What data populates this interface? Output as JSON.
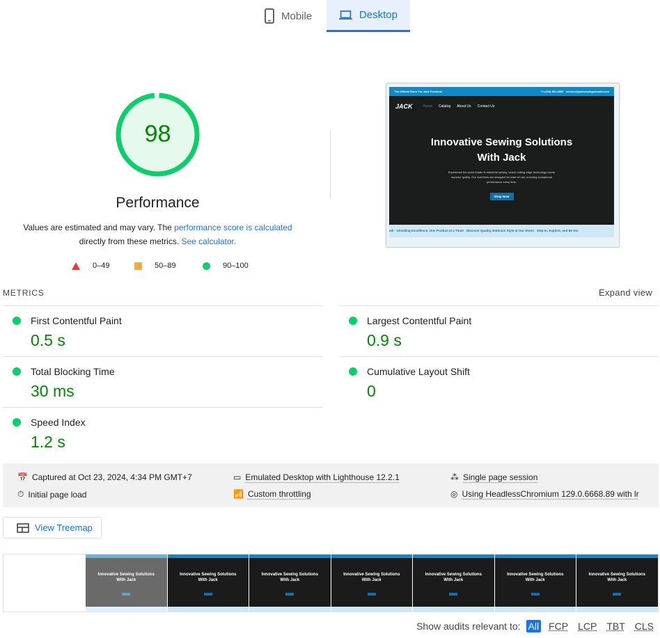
{
  "tabs": [
    {
      "label": "Mobile",
      "icon": "phone-icon"
    },
    {
      "label": "Desktop",
      "icon": "laptop-icon",
      "active": true
    }
  ],
  "score": {
    "value": "98",
    "title": "Performance",
    "fraction": 0.98,
    "color": "#0cce6b"
  },
  "description": {
    "text1": "Values are estimated and may vary. The ",
    "link1": "performance score is calculated",
    "text2": "directly from these metrics. ",
    "link2": "See calculator."
  },
  "legend": [
    {
      "range": "0–49",
      "color": "#ff3333"
    },
    {
      "range": "50–89",
      "color": "#ffaa33"
    },
    {
      "range": "90–100",
      "color": "#0cce6b"
    }
  ],
  "screenshot": {
    "topbar": "The Official Store For Jack Products",
    "phone": "+1 (416) 561-6660",
    "email": "service@jacksewingcanada.com",
    "logo": "JACK",
    "nav": [
      "Home",
      "Catalog",
      "About Us",
      "Contact Us"
    ],
    "headline1": "Innovative Sewing Solutions",
    "headline2": "With Jack",
    "body": "Experience the world leader in industrial sewing, where cutting-edge technology meets superior quality. Our machines are designed for ease of use, ensuring exceptional performance every time.",
    "cta": "Shop Now",
    "marquee": "ed!   Unveiling Excellence, One Product at a Time!   Discover Quality, Embrace Style at Our Store!   Step In, Explore, and Be Ins"
  },
  "metrics": {
    "heading": "METRICS",
    "expand": "Expand view",
    "items": [
      {
        "label": "First Contentful Paint",
        "value": "0.5 s"
      },
      {
        "label": "Largest Contentful Paint",
        "value": "0.9 s"
      },
      {
        "label": "Total Blocking Time",
        "value": "30 ms"
      },
      {
        "label": "Cumulative Layout Shift",
        "value": "0"
      },
      {
        "label": "Speed Index",
        "value": "1.2 s"
      }
    ]
  },
  "info": {
    "captured": "Captured at Oct 23, 2024, 4:34 PM GMT+7",
    "emulated": "Emulated Desktop with Lighthouse 12.2.1",
    "session": "Single page session",
    "load": "Initial page load",
    "throttling": "Custom throttling",
    "browser": "Using HeadlessChromium 129.0.6668.89 with lr"
  },
  "treemap": "View Treemap",
  "filter": {
    "label": "Show audits relevant to:",
    "chips": [
      "All",
      "FCP",
      "LCP",
      "TBT",
      "CLS"
    ]
  }
}
